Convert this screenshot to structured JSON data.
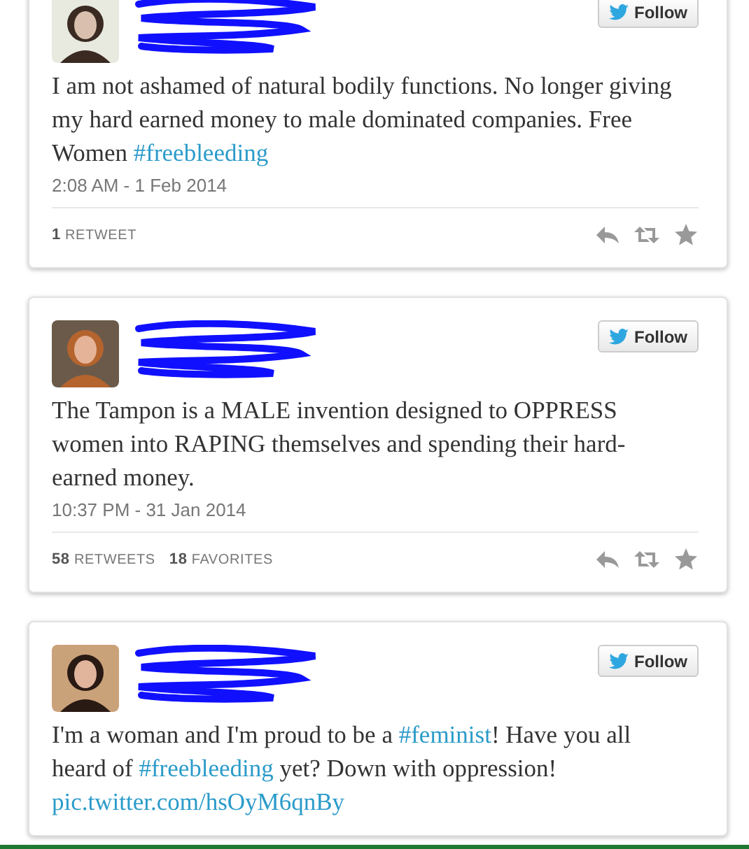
{
  "tweets": [
    {
      "author": {
        "redacted": true
      },
      "follow_label": "Follow",
      "segments": [
        {
          "kind": "text",
          "text": "I am not ashamed of natural bodily functions. No longer giving my hard earned money to male dominated companies. Free Women "
        },
        {
          "kind": "hashtag",
          "text": "#freebleeding"
        }
      ],
      "timestamp": "2:08 AM - 1 Feb 2014",
      "stats": [
        {
          "count": "1",
          "label": "RETWEET"
        }
      ]
    },
    {
      "author": {
        "redacted": true
      },
      "follow_label": "Follow",
      "segments": [
        {
          "kind": "text",
          "text": "The Tampon is a MALE invention designed to OPPRESS women into RAPING themselves and spending their hard-earned money."
        }
      ],
      "timestamp": "10:37 PM - 31 Jan 2014",
      "stats": [
        {
          "count": "58",
          "label": "RETWEETS"
        },
        {
          "count": "18",
          "label": "FAVORITES"
        }
      ]
    },
    {
      "author": {
        "redacted": true
      },
      "follow_label": "Follow",
      "segments": [
        {
          "kind": "text",
          "text": "I'm a woman and I'm proud to be a "
        },
        {
          "kind": "hashtag",
          "text": "#feminist"
        },
        {
          "kind": "text",
          "text": "! Have you all heard of "
        },
        {
          "kind": "hashtag",
          "text": "#freebleeding"
        },
        {
          "kind": "text",
          "text": " yet? Down with oppression! "
        },
        {
          "kind": "link",
          "text": "pic.twitter.com/hsOyM6qnBy"
        }
      ]
    }
  ]
}
